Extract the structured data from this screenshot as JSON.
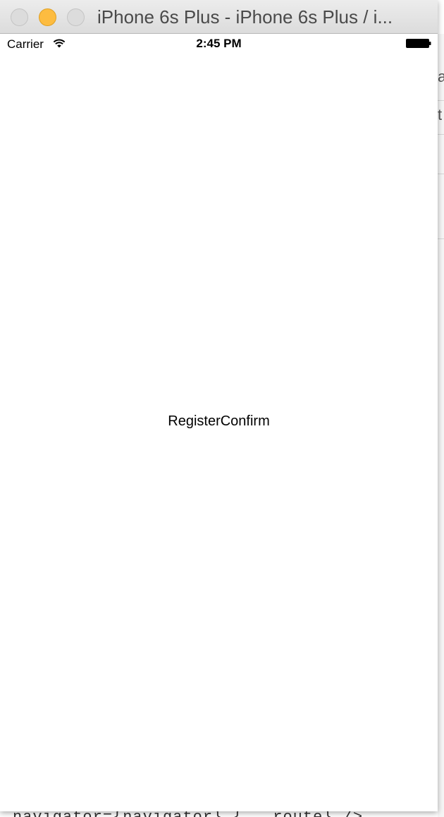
{
  "window": {
    "title": "iPhone 6s Plus - iPhone 6s Plus / i..."
  },
  "status_bar": {
    "carrier": "Carrier",
    "time": "2:45 PM"
  },
  "screen": {
    "label": "RegisterConfirm"
  },
  "background": {
    "fragment_1": "a",
    "fragment_2": "t",
    "code_line": "navigator={navigator} {...route} />"
  },
  "colors": {
    "minimize_button": "#fdbc40",
    "screen_background": "#ffffff"
  },
  "icons": {
    "wifi": "wifi-icon",
    "battery": "battery-icon"
  }
}
